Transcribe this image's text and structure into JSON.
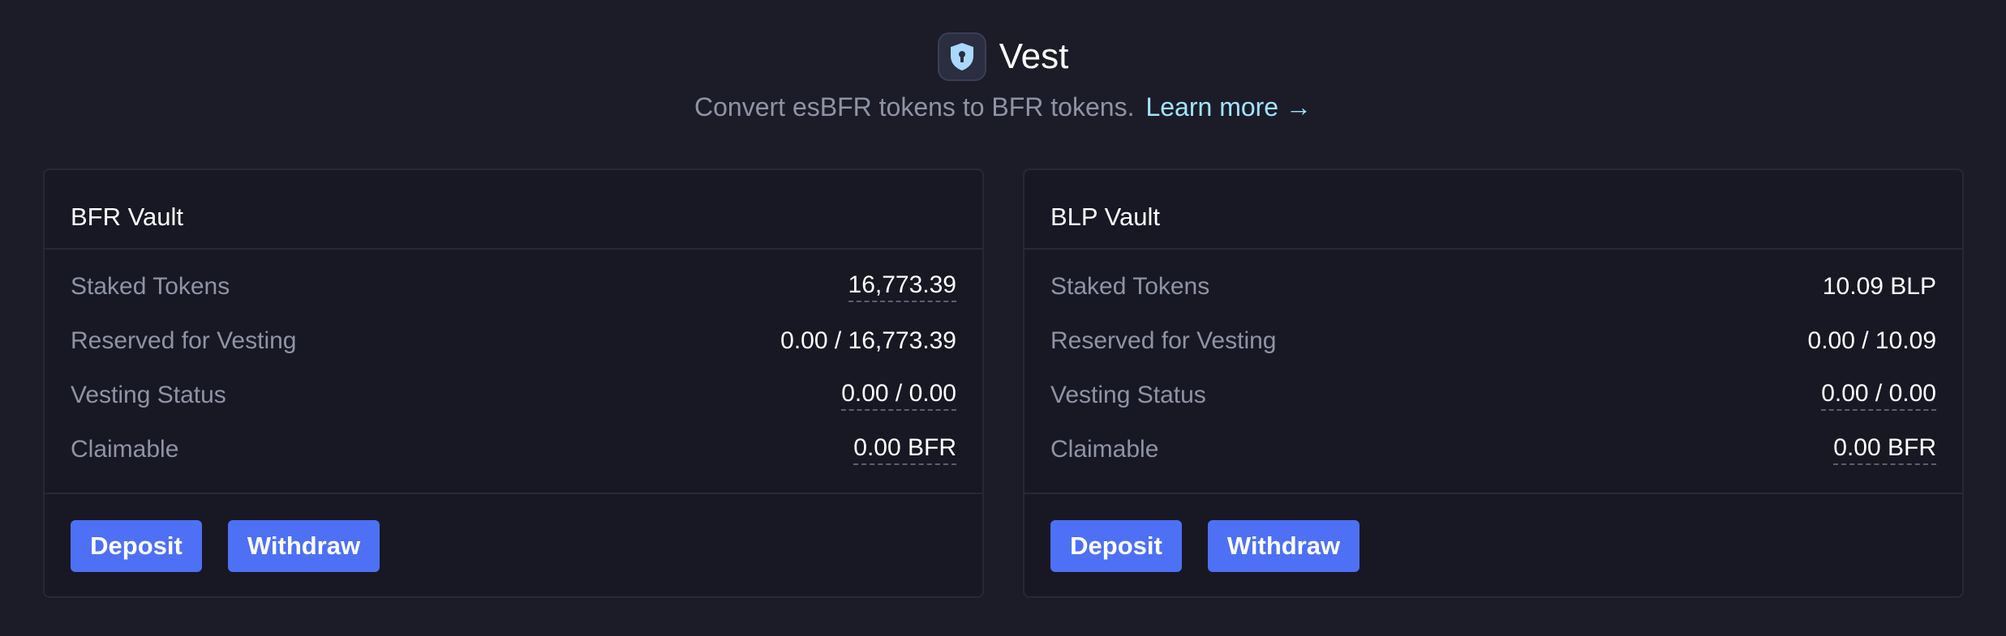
{
  "header": {
    "title": "Vest",
    "subtitle": "Convert esBFR tokens to BFR tokens.",
    "learn_more": "Learn more →",
    "icon": "shield-lock-icon"
  },
  "vaults": [
    {
      "title": "BFR Vault",
      "rows": [
        {
          "label": "Staked Tokens",
          "value": "16,773.39"
        },
        {
          "label": "Reserved for Vesting",
          "value": "0.00 / 16,773.39"
        },
        {
          "label": "Vesting Status",
          "value": "0.00 / 0.00"
        },
        {
          "label": "Claimable",
          "value": "0.00 BFR"
        }
      ],
      "deposit_label": "Deposit",
      "withdraw_label": "Withdraw"
    },
    {
      "title": "BLP Vault",
      "rows": [
        {
          "label": "Staked Tokens",
          "value": "10.09 BLP"
        },
        {
          "label": "Reserved for Vesting",
          "value": "0.00 / 10.09"
        },
        {
          "label": "Vesting Status",
          "value": "0.00 / 0.00"
        },
        {
          "label": "Claimable",
          "value": "0.00 BFR"
        }
      ],
      "deposit_label": "Deposit",
      "withdraw_label": "Withdraw"
    }
  ],
  "colors": {
    "background": "#1c1c28",
    "card": "#181824",
    "accent_button": "#4e70f5",
    "link": "#a3e3ff",
    "muted_text": "#8f93a6"
  }
}
